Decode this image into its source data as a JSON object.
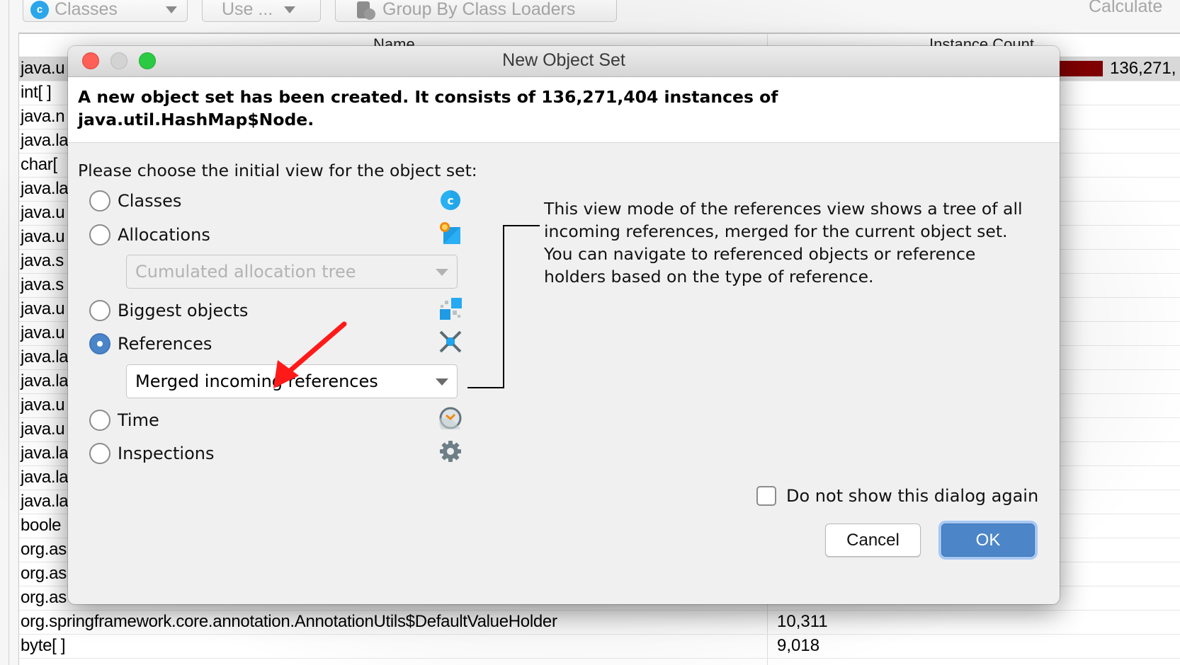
{
  "toolbar": {
    "view_select": {
      "label": "Classes",
      "icon": "class-c-icon"
    },
    "use_select": {
      "label": "Use ..."
    },
    "group_button": {
      "label": "Group By Class Loaders",
      "icon": "class-loader-icon"
    },
    "calculate_label": "Calculate"
  },
  "table": {
    "columns": [
      "Name",
      "Instance Count"
    ],
    "rows": [
      {
        "name": "java.u",
        "count": "136,271,",
        "selected": true,
        "bar_fraction": 1.0
      },
      {
        "name": "int[ ]",
        "count": ""
      },
      {
        "name": "java.n",
        "count": ""
      },
      {
        "name": "java.la",
        "count": ""
      },
      {
        "name": "char[",
        "count": ""
      },
      {
        "name": "java.la",
        "count": ""
      },
      {
        "name": "java.u",
        "count": ""
      },
      {
        "name": "java.u",
        "count": ""
      },
      {
        "name": "java.s",
        "count": ""
      },
      {
        "name": "java.s",
        "count": ""
      },
      {
        "name": "java.u",
        "count": ""
      },
      {
        "name": "java.u",
        "count": ""
      },
      {
        "name": "java.la",
        "count": ""
      },
      {
        "name": "java.la",
        "count": ""
      },
      {
        "name": "java.u",
        "count": ""
      },
      {
        "name": "java.u",
        "count": ""
      },
      {
        "name": "java.la",
        "count": ""
      },
      {
        "name": "java.la",
        "count": ""
      },
      {
        "name": "java.la",
        "count": ""
      },
      {
        "name": "boole",
        "count": ""
      },
      {
        "name": "org.as",
        "count": ""
      },
      {
        "name": "org.as",
        "count": ""
      },
      {
        "name": "org.as",
        "count": ""
      },
      {
        "name": "org.springframework.core.annotation.AnnotationUtils$DefaultValueHolder",
        "count": "10,311"
      },
      {
        "name": "byte[ ]",
        "count": "9,018"
      }
    ]
  },
  "dialog": {
    "title": "New Object Set",
    "message": "A new object set has been created. It consists of 136,271,404 instances of java.util.HashMap$Node.",
    "prompt": "Please choose the initial view for the object set:",
    "options": [
      {
        "label": "Classes",
        "icon": "class-c-icon",
        "checked": false
      },
      {
        "label": "Allocations",
        "icon": "allocations-icon",
        "checked": false
      },
      {
        "label": "Biggest objects",
        "icon": "biggest-objects-icon",
        "checked": false
      },
      {
        "label": "References",
        "icon": "references-icon",
        "checked": true
      },
      {
        "label": "Time",
        "icon": "clock-icon",
        "checked": false
      },
      {
        "label": "Inspections",
        "icon": "gear-icon",
        "checked": false
      }
    ],
    "allocations_combo": {
      "value": "Cumulated allocation tree",
      "disabled": true
    },
    "references_combo": {
      "value": "Merged incoming references",
      "disabled": false
    },
    "description": "This view mode of the references view shows a tree of all incoming references, merged for the current object set. You can navigate to referenced objects or reference holders based on the type of reference.",
    "dont_show_again": {
      "label": "Do not show this dialog again",
      "checked": false
    },
    "cancel_label": "Cancel",
    "ok_label": "OK"
  },
  "colors": {
    "accent": "#4d86c8",
    "bar": "#7f0000",
    "annotation_arrow": "#ff0000"
  }
}
